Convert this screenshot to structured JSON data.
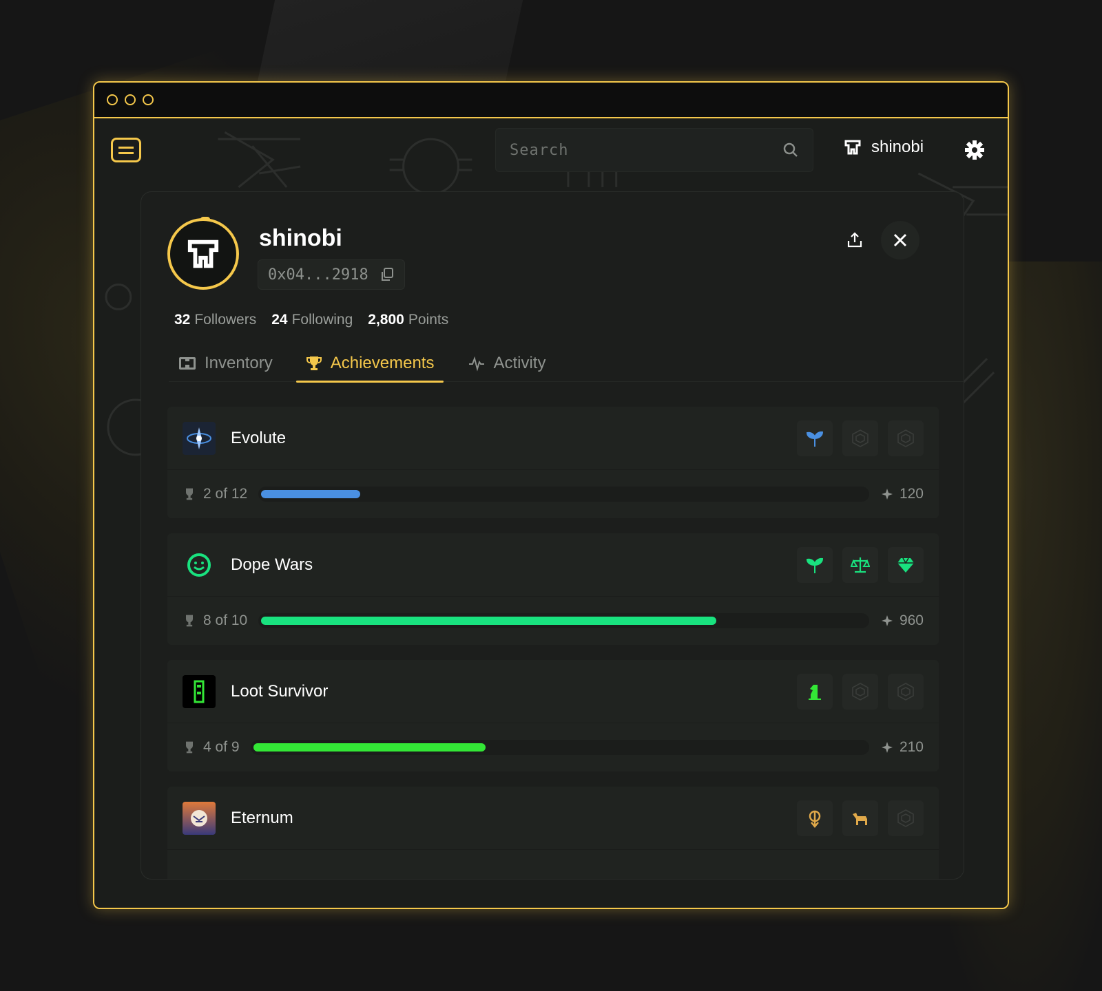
{
  "window": {
    "dots": 3
  },
  "topbar": {
    "search_placeholder": "Search",
    "username": "shinobi"
  },
  "profile": {
    "name": "shinobi",
    "address": "0x04...2918",
    "stats": [
      {
        "value": "32",
        "label": "Followers"
      },
      {
        "value": "24",
        "label": "Following"
      },
      {
        "value": "2,800",
        "label": "Points"
      }
    ]
  },
  "tabs": [
    {
      "label": "Inventory",
      "icon": "chest-icon"
    },
    {
      "label": "Achievements",
      "icon": "trophy-icon",
      "active": true
    },
    {
      "label": "Activity",
      "icon": "pulse-icon"
    }
  ],
  "colors": {
    "accent": "#f5c84b",
    "evolute": "#4a90e2",
    "dope": "#19e27f",
    "loot": "#33e636",
    "eternum": "#e0a94a"
  },
  "games": [
    {
      "name": "Evolute",
      "progress": "2 of 12",
      "fraction": 0.167,
      "points": "120",
      "color": "#4a90e2",
      "badges": [
        "sprout-icon",
        "locked-badge-icon",
        "locked-badge-icon"
      ]
    },
    {
      "name": "Dope Wars",
      "progress": "8 of 10",
      "fraction": 0.75,
      "points": "960",
      "color": "#19e27f",
      "badges": [
        "sprout-icon",
        "scales-icon",
        "gem-icon"
      ]
    },
    {
      "name": "Loot Survivor",
      "progress": "4 of 9",
      "fraction": 0.38,
      "points": "210",
      "color": "#33e636",
      "badges": [
        "chess-knight-icon",
        "locked-badge-icon",
        "locked-badge-icon"
      ]
    },
    {
      "name": "Eternum",
      "progress": "",
      "fraction": 0,
      "points": "",
      "color": "#e0a94a",
      "badges": [
        "crest-icon",
        "horse-icon",
        "locked-badge-icon"
      ]
    }
  ]
}
